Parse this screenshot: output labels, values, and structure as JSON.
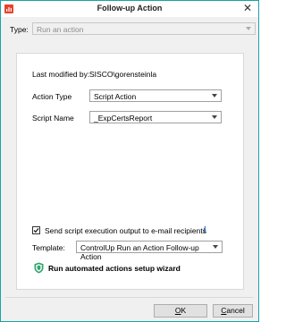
{
  "window": {
    "title": "Follow-up Action",
    "close_symbol": "✕"
  },
  "type_row": {
    "label": "Type:",
    "value": "Run an action"
  },
  "details": {
    "last_modified_label": "Last modified by:",
    "last_modified_value": "SISCO\\gorensteinla",
    "action_type_label": "Action Type",
    "action_type_value": "Script Action",
    "script_name_label": "Script Name",
    "script_name_value": "_ExpCertsReport"
  },
  "email_option": {
    "checked": true,
    "label": "Send script execution output to e-mail recipients",
    "info_symbol": "i"
  },
  "template": {
    "label": "Template:",
    "value": "ControlUp Run an Action Follow-up Action"
  },
  "wizard": {
    "label": "Run automated actions setup wizard",
    "icon": "shield-icon"
  },
  "buttons": {
    "ok_prefix": "O",
    "ok_rest": "K",
    "cancel_prefix": "C",
    "cancel_rest": "ancel"
  },
  "colors": {
    "window_border": "#19a3a5",
    "app_icon": "#e8412a",
    "shield": "#2ea66a",
    "info": "#2367b7"
  }
}
